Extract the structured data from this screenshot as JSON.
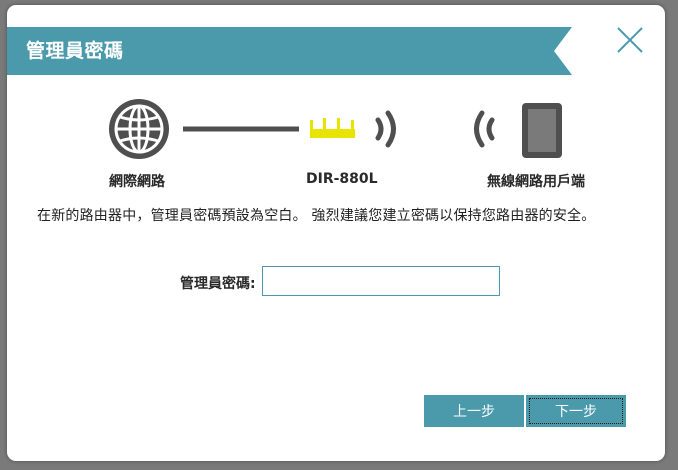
{
  "dialog": {
    "title": "管理員密碼",
    "close_icon": "close-icon"
  },
  "diagram": {
    "internet_label": "網際網路",
    "router_label": "DIR-880L",
    "client_label": "無線網路用戶端",
    "icons": [
      "globe-icon",
      "connection-line",
      "router-icon",
      "wifi-waves-icon",
      "tablet-icon"
    ]
  },
  "intro_text": "在新的路由器中，管理員密碼預設為空白。 強烈建議您建立密碼以保持您路由器的安全。",
  "password": {
    "label": "管理員密碼:",
    "value": "",
    "placeholder": ""
  },
  "buttons": {
    "prev_label": "上一步",
    "next_label": "下一步"
  },
  "colors": {
    "accent": "#4a9aab",
    "router_yellow": "#e8e400",
    "icon_gray": "#4f4f4f"
  }
}
